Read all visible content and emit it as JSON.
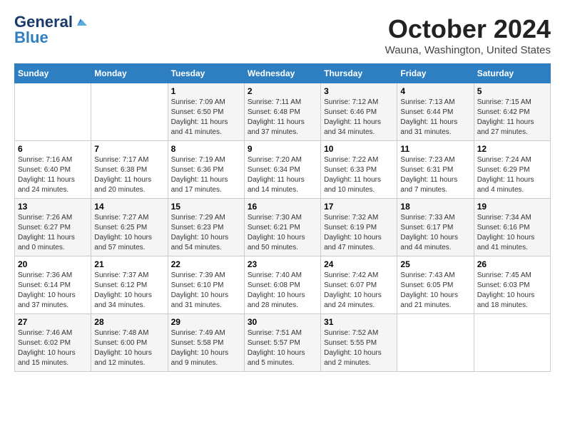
{
  "header": {
    "logo_general": "General",
    "logo_blue": "Blue",
    "month_title": "October 2024",
    "location": "Wauna, Washington, United States"
  },
  "weekdays": [
    "Sunday",
    "Monday",
    "Tuesday",
    "Wednesday",
    "Thursday",
    "Friday",
    "Saturday"
  ],
  "weeks": [
    [
      {
        "day": "",
        "sunrise": "",
        "sunset": "",
        "daylight": ""
      },
      {
        "day": "",
        "sunrise": "",
        "sunset": "",
        "daylight": ""
      },
      {
        "day": "1",
        "sunrise": "Sunrise: 7:09 AM",
        "sunset": "Sunset: 6:50 PM",
        "daylight": "Daylight: 11 hours and 41 minutes."
      },
      {
        "day": "2",
        "sunrise": "Sunrise: 7:11 AM",
        "sunset": "Sunset: 6:48 PM",
        "daylight": "Daylight: 11 hours and 37 minutes."
      },
      {
        "day": "3",
        "sunrise": "Sunrise: 7:12 AM",
        "sunset": "Sunset: 6:46 PM",
        "daylight": "Daylight: 11 hours and 34 minutes."
      },
      {
        "day": "4",
        "sunrise": "Sunrise: 7:13 AM",
        "sunset": "Sunset: 6:44 PM",
        "daylight": "Daylight: 11 hours and 31 minutes."
      },
      {
        "day": "5",
        "sunrise": "Sunrise: 7:15 AM",
        "sunset": "Sunset: 6:42 PM",
        "daylight": "Daylight: 11 hours and 27 minutes."
      }
    ],
    [
      {
        "day": "6",
        "sunrise": "Sunrise: 7:16 AM",
        "sunset": "Sunset: 6:40 PM",
        "daylight": "Daylight: 11 hours and 24 minutes."
      },
      {
        "day": "7",
        "sunrise": "Sunrise: 7:17 AM",
        "sunset": "Sunset: 6:38 PM",
        "daylight": "Daylight: 11 hours and 20 minutes."
      },
      {
        "day": "8",
        "sunrise": "Sunrise: 7:19 AM",
        "sunset": "Sunset: 6:36 PM",
        "daylight": "Daylight: 11 hours and 17 minutes."
      },
      {
        "day": "9",
        "sunrise": "Sunrise: 7:20 AM",
        "sunset": "Sunset: 6:34 PM",
        "daylight": "Daylight: 11 hours and 14 minutes."
      },
      {
        "day": "10",
        "sunrise": "Sunrise: 7:22 AM",
        "sunset": "Sunset: 6:33 PM",
        "daylight": "Daylight: 11 hours and 10 minutes."
      },
      {
        "day": "11",
        "sunrise": "Sunrise: 7:23 AM",
        "sunset": "Sunset: 6:31 PM",
        "daylight": "Daylight: 11 hours and 7 minutes."
      },
      {
        "day": "12",
        "sunrise": "Sunrise: 7:24 AM",
        "sunset": "Sunset: 6:29 PM",
        "daylight": "Daylight: 11 hours and 4 minutes."
      }
    ],
    [
      {
        "day": "13",
        "sunrise": "Sunrise: 7:26 AM",
        "sunset": "Sunset: 6:27 PM",
        "daylight": "Daylight: 11 hours and 0 minutes."
      },
      {
        "day": "14",
        "sunrise": "Sunrise: 7:27 AM",
        "sunset": "Sunset: 6:25 PM",
        "daylight": "Daylight: 10 hours and 57 minutes."
      },
      {
        "day": "15",
        "sunrise": "Sunrise: 7:29 AM",
        "sunset": "Sunset: 6:23 PM",
        "daylight": "Daylight: 10 hours and 54 minutes."
      },
      {
        "day": "16",
        "sunrise": "Sunrise: 7:30 AM",
        "sunset": "Sunset: 6:21 PM",
        "daylight": "Daylight: 10 hours and 50 minutes."
      },
      {
        "day": "17",
        "sunrise": "Sunrise: 7:32 AM",
        "sunset": "Sunset: 6:19 PM",
        "daylight": "Daylight: 10 hours and 47 minutes."
      },
      {
        "day": "18",
        "sunrise": "Sunrise: 7:33 AM",
        "sunset": "Sunset: 6:17 PM",
        "daylight": "Daylight: 10 hours and 44 minutes."
      },
      {
        "day": "19",
        "sunrise": "Sunrise: 7:34 AM",
        "sunset": "Sunset: 6:16 PM",
        "daylight": "Daylight: 10 hours and 41 minutes."
      }
    ],
    [
      {
        "day": "20",
        "sunrise": "Sunrise: 7:36 AM",
        "sunset": "Sunset: 6:14 PM",
        "daylight": "Daylight: 10 hours and 37 minutes."
      },
      {
        "day": "21",
        "sunrise": "Sunrise: 7:37 AM",
        "sunset": "Sunset: 6:12 PM",
        "daylight": "Daylight: 10 hours and 34 minutes."
      },
      {
        "day": "22",
        "sunrise": "Sunrise: 7:39 AM",
        "sunset": "Sunset: 6:10 PM",
        "daylight": "Daylight: 10 hours and 31 minutes."
      },
      {
        "day": "23",
        "sunrise": "Sunrise: 7:40 AM",
        "sunset": "Sunset: 6:08 PM",
        "daylight": "Daylight: 10 hours and 28 minutes."
      },
      {
        "day": "24",
        "sunrise": "Sunrise: 7:42 AM",
        "sunset": "Sunset: 6:07 PM",
        "daylight": "Daylight: 10 hours and 24 minutes."
      },
      {
        "day": "25",
        "sunrise": "Sunrise: 7:43 AM",
        "sunset": "Sunset: 6:05 PM",
        "daylight": "Daylight: 10 hours and 21 minutes."
      },
      {
        "day": "26",
        "sunrise": "Sunrise: 7:45 AM",
        "sunset": "Sunset: 6:03 PM",
        "daylight": "Daylight: 10 hours and 18 minutes."
      }
    ],
    [
      {
        "day": "27",
        "sunrise": "Sunrise: 7:46 AM",
        "sunset": "Sunset: 6:02 PM",
        "daylight": "Daylight: 10 hours and 15 minutes."
      },
      {
        "day": "28",
        "sunrise": "Sunrise: 7:48 AM",
        "sunset": "Sunset: 6:00 PM",
        "daylight": "Daylight: 10 hours and 12 minutes."
      },
      {
        "day": "29",
        "sunrise": "Sunrise: 7:49 AM",
        "sunset": "Sunset: 5:58 PM",
        "daylight": "Daylight: 10 hours and 9 minutes."
      },
      {
        "day": "30",
        "sunrise": "Sunrise: 7:51 AM",
        "sunset": "Sunset: 5:57 PM",
        "daylight": "Daylight: 10 hours and 5 minutes."
      },
      {
        "day": "31",
        "sunrise": "Sunrise: 7:52 AM",
        "sunset": "Sunset: 5:55 PM",
        "daylight": "Daylight: 10 hours and 2 minutes."
      },
      {
        "day": "",
        "sunrise": "",
        "sunset": "",
        "daylight": ""
      },
      {
        "day": "",
        "sunrise": "",
        "sunset": "",
        "daylight": ""
      }
    ]
  ]
}
